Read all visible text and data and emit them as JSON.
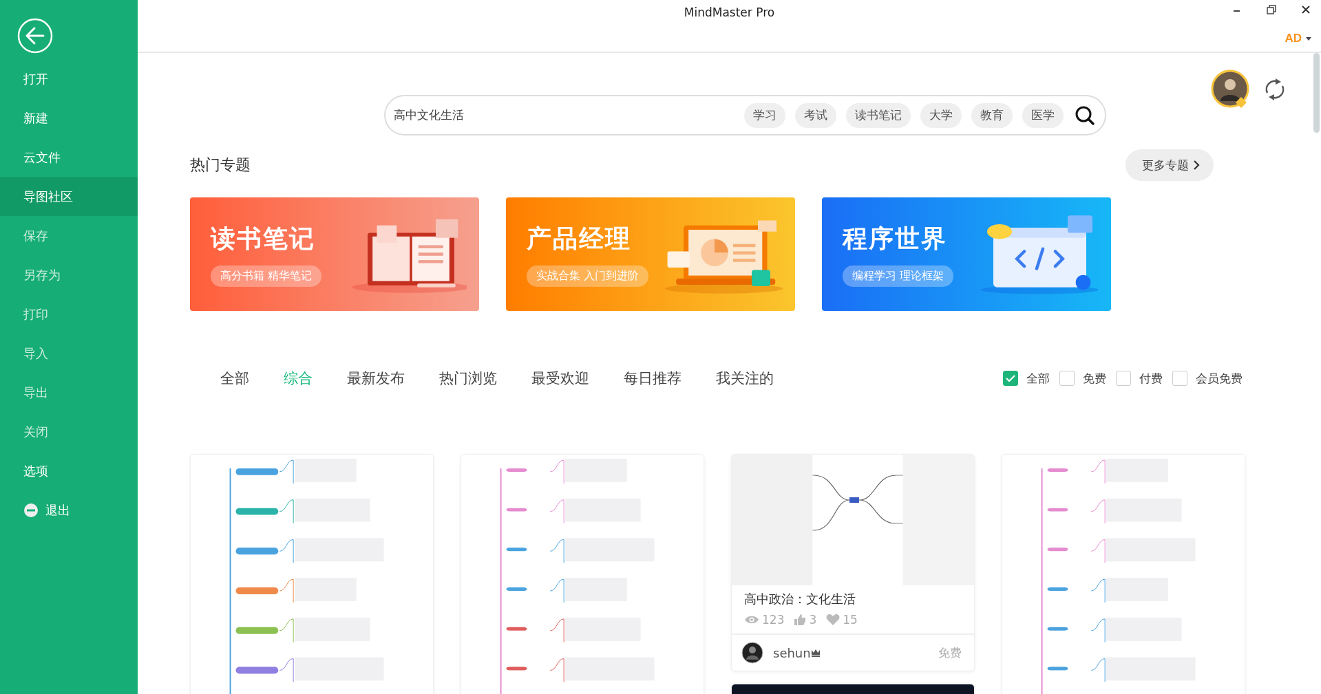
{
  "window": {
    "title": "MindMaster Pro",
    "account": "AD"
  },
  "sidebar": {
    "items": [
      {
        "label": "打开",
        "kind": "item",
        "disabled": false,
        "selected": false
      },
      {
        "label": "新建",
        "kind": "item",
        "disabled": false,
        "selected": false
      },
      {
        "label": "云文件",
        "kind": "item",
        "disabled": false,
        "selected": false
      },
      {
        "label": "导图社区",
        "kind": "item",
        "disabled": false,
        "selected": true
      },
      {
        "label": "保存",
        "kind": "item",
        "disabled": true,
        "selected": false
      },
      {
        "label": "另存为",
        "kind": "item",
        "disabled": true,
        "selected": false
      },
      {
        "label": "打印",
        "kind": "item",
        "disabled": true,
        "selected": false
      },
      {
        "label": "导入",
        "kind": "item",
        "disabled": true,
        "selected": false
      },
      {
        "label": "导出",
        "kind": "item",
        "disabled": true,
        "selected": false
      },
      {
        "label": "关闭",
        "kind": "item",
        "disabled": true,
        "selected": false
      },
      {
        "label": "选项",
        "kind": "item",
        "disabled": false,
        "selected": false
      },
      {
        "label": "退出",
        "kind": "exit",
        "disabled": false,
        "selected": false
      }
    ]
  },
  "search": {
    "value": "高中文化生活",
    "tags": [
      "学习",
      "考试",
      "读书笔记",
      "大学",
      "教育",
      "医学"
    ]
  },
  "topics": {
    "heading": "热门专题",
    "more": "更多专题",
    "banners": [
      {
        "kind": "book",
        "title": "读书笔记",
        "subtitle": "高分书籍 精华笔记"
      },
      {
        "kind": "laptop",
        "title": "产品经理",
        "subtitle": "实战合集 入门到进阶"
      },
      {
        "kind": "code",
        "title": "程序世界",
        "subtitle": "编程学习 理论框架"
      }
    ]
  },
  "filters": {
    "tabs": [
      {
        "label": "全部",
        "selected": false
      },
      {
        "label": "综合",
        "selected": true
      },
      {
        "label": "最新发布",
        "selected": false
      },
      {
        "label": "热门浏览",
        "selected": false
      },
      {
        "label": "最受欢迎",
        "selected": false
      },
      {
        "label": "每日推荐",
        "selected": false
      },
      {
        "label": "我关注的",
        "selected": false
      }
    ],
    "options": [
      {
        "label": "全部",
        "checked": true
      },
      {
        "label": "免费",
        "checked": false
      },
      {
        "label": "付费",
        "checked": false
      },
      {
        "label": "会员免费",
        "checked": false
      }
    ]
  },
  "card_columns": [
    {
      "cards": [
        {
          "kind": "picture"
        }
      ]
    },
    {
      "cards": [
        {
          "kind": "picture"
        }
      ]
    },
    {
      "cards": [
        {
          "kind": "detail",
          "title": "高中政治：文化生活",
          "views": "123",
          "likes": "3",
          "favorites": "15",
          "author": "sehun",
          "price": "免费"
        },
        {
          "kind": "dark"
        }
      ]
    },
    {
      "cards": [
        {
          "kind": "picture"
        }
      ]
    }
  ]
}
